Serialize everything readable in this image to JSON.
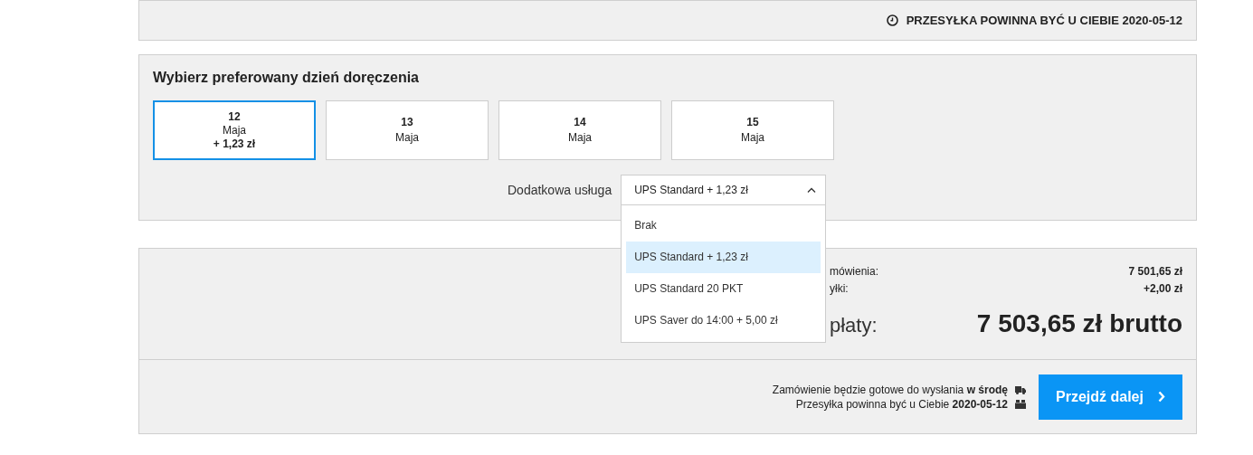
{
  "delivery_notice": {
    "text": "PRZESYŁKA POWINNA BYĆ U CIEBIE 2020-05-12"
  },
  "delivery_day": {
    "title": "Wybierz preferowany dzień doręczenia",
    "days": [
      {
        "day": "12",
        "month": "Maja",
        "surcharge": "+ 1,23 zł",
        "selected": true
      },
      {
        "day": "13",
        "month": "Maja",
        "selected": false
      },
      {
        "day": "14",
        "month": "Maja",
        "selected": false
      },
      {
        "day": "15",
        "month": "Maja",
        "selected": false
      }
    ],
    "service": {
      "label": "Dodatkowa usługa",
      "value": "UPS Standard + 1,23 zł",
      "expanded": true,
      "options": [
        {
          "label": "Brak",
          "selected": false
        },
        {
          "label": "UPS Standard + 1,23 zł",
          "selected": true
        },
        {
          "label": "UPS Standard 20 PKT",
          "selected": false
        },
        {
          "label": "UPS Saver do 14:00 + 5,00 zł",
          "selected": false
        }
      ]
    }
  },
  "summary": {
    "rows": [
      {
        "label": "mówienia:",
        "value": "7 501,65 zł"
      },
      {
        "label": "yłki:",
        "value": "+2,00 zł"
      }
    ],
    "total": {
      "label": "płaty:",
      "value": "7 503,65 zł brutto"
    }
  },
  "footer": {
    "lines": [
      {
        "text": "Zamówienie będzie gotowe do wysłania **w środę**",
        "kind": "truck"
      },
      {
        "text": "Przesyłka powinna być u Ciebie **2020-05-12**",
        "kind": "box"
      }
    ],
    "button": "Przejdź dalej"
  }
}
